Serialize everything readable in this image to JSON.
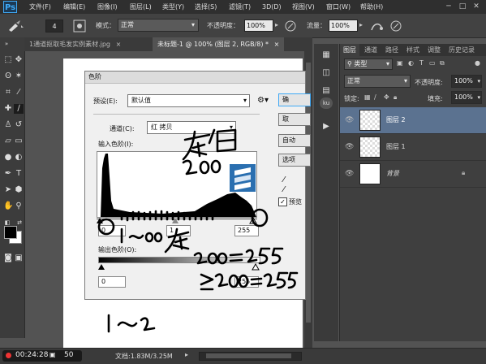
{
  "app": {
    "logo": "Ps"
  },
  "menubar": {
    "items": [
      "文件(F)",
      "编辑(E)",
      "图像(I)",
      "图层(L)",
      "类型(Y)",
      "选择(S)",
      "滤镜(T)",
      "3D(D)",
      "视图(V)",
      "窗口(W)",
      "帮助(H)"
    ]
  },
  "options": {
    "brush_size": "4",
    "mode_label": "模式：",
    "mode_value": "正常",
    "opacity_label": "不透明度：",
    "opacity_value": "100%",
    "flow_label": "流量：",
    "flow_value": "100%"
  },
  "tabs": [
    {
      "label": "1通道抠取毛发实例素材.jpg",
      "close": "×"
    },
    {
      "label": "未标题-1 @ 100% (图层 2, RGB/8) *",
      "close": "×"
    }
  ],
  "levels_dialog": {
    "title": "色阶",
    "preset_label": "预设(E):",
    "preset_value": "默认值",
    "channel_label": "通道(C):",
    "channel_value": "红 拷贝",
    "input_label": "输入色阶(I):",
    "input_values": [
      "0",
      "1",
      "255"
    ],
    "output_label": "输出色阶(O):",
    "output_values": [
      "0",
      "255"
    ],
    "buttons": [
      "确",
      "取",
      "自动",
      "选项"
    ],
    "preview_label": "预览",
    "preview_checked": true
  },
  "annotations": {
    "hw1": "灰白",
    "hw2": "200",
    "hw3": "1～00",
    "hw4": "灰",
    "hw5": "200 = 255",
    "hw6": "≥200 = 255",
    "hw7": "1～2"
  },
  "layers_panel": {
    "tabs": [
      "图层",
      "通道",
      "路径",
      "样式",
      "调整",
      "历史记录"
    ],
    "kind_filter": "类型",
    "blend_mode": "正常",
    "opacity_label": "不透明度:",
    "opacity_value": "100%",
    "lock_label": "锁定:",
    "fill_label": "填充:",
    "fill_value": "100%",
    "layers": [
      {
        "name": "图层 2",
        "selected": true
      },
      {
        "name": "图层 1",
        "selected": false
      },
      {
        "name": "背景",
        "selected": false
      }
    ],
    "footer_icons": [
      "link-icon",
      "fx",
      "mask-icon",
      "adjustment-icon",
      "folder-icon",
      "new-layer-icon",
      "trash-icon"
    ]
  },
  "status": {
    "timer": "00:24:28",
    "zoom": "50",
    "doc": "文档:1.83M/3.25M"
  },
  "colors": {
    "accent": "#3fa9f5",
    "layer_selected": "#5b7290",
    "panel_bg": "#3f3f3f",
    "menubar_bg": "#2f2f2f"
  }
}
